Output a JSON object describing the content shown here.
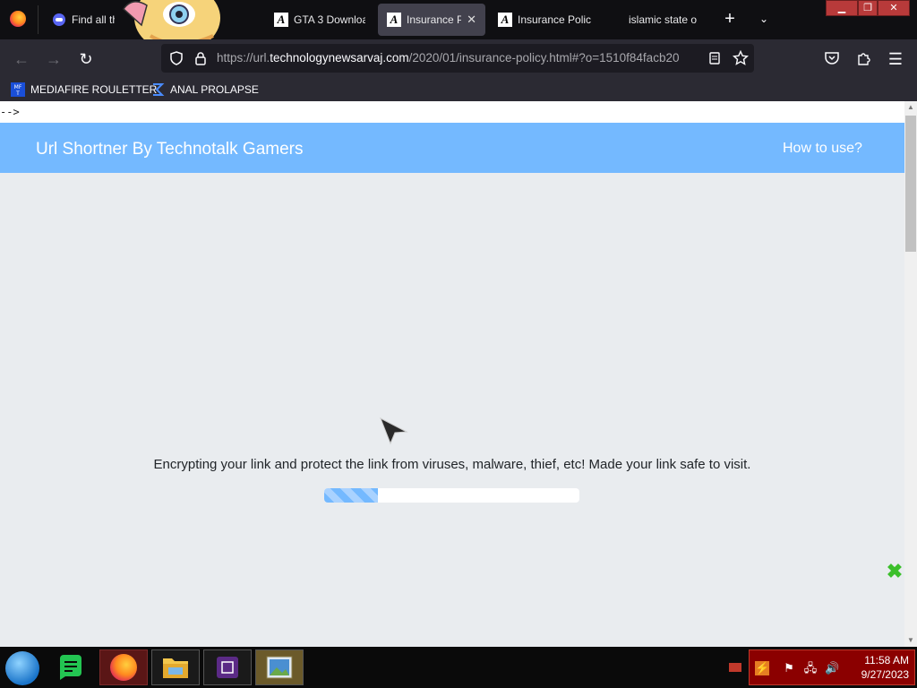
{
  "browser": {
    "tabs": [
      {
        "label": "Find all th",
        "icon": "discord-icon",
        "active": false
      },
      {
        "label": "GTA 3 Downloa",
        "icon": "site-a-icon",
        "active": false
      },
      {
        "label": "Insurance Po",
        "icon": "site-a-icon",
        "active": true
      },
      {
        "label": "Insurance Polic",
        "icon": "site-a-icon",
        "active": false
      },
      {
        "label": "islamic state of",
        "icon": "none",
        "active": false
      }
    ],
    "new_tab_glyph": "+",
    "tab_list_glyph": "⌄",
    "url_prefix": "https://url.",
    "url_host": "technologynewsarvaj.com",
    "url_path": "/2020/01/insurance-policy.html#?o=1510f84facb20",
    "bookmarks": [
      {
        "label": "MEDIAFIRE ROULETTER",
        "icon": "mediafire-icon"
      },
      {
        "label": "ANAL PROLAPSE",
        "icon": "sigma-icon"
      }
    ]
  },
  "page": {
    "stray_text": "-->",
    "site_title": "Url Shortner By Technotalk Gamers",
    "how_to_use": "How to use?",
    "message": "Encrypting your link and protect the link from viruses, malware, thief, etc! Made your link safe to visit.",
    "progress_fraction": 0.21,
    "accent_color": "#74b9ff"
  },
  "taskbar": {
    "time": "11:58 AM",
    "date": "9/27/2023"
  }
}
